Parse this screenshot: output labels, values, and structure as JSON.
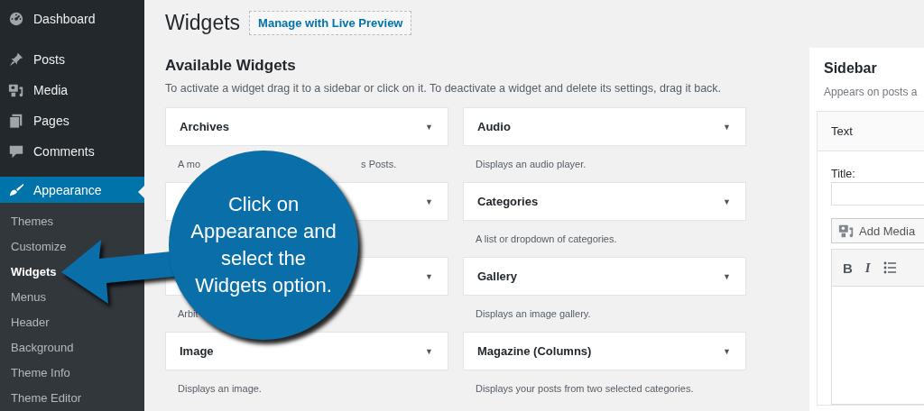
{
  "admin_menu": [
    {
      "label": "Dashboard",
      "selected": false
    },
    {
      "label": "Posts",
      "selected": false
    },
    {
      "label": "Media",
      "selected": false
    },
    {
      "label": "Pages",
      "selected": false
    },
    {
      "label": "Comments",
      "selected": false
    },
    {
      "label": "Appearance",
      "selected": true
    }
  ],
  "submenu": [
    {
      "label": "Themes",
      "selected": false
    },
    {
      "label": "Customize",
      "selected": false
    },
    {
      "label": "Widgets",
      "selected": true
    },
    {
      "label": "Menus",
      "selected": false
    },
    {
      "label": "Header",
      "selected": false
    },
    {
      "label": "Background",
      "selected": false
    },
    {
      "label": "Theme Info",
      "selected": false
    },
    {
      "label": "Theme Editor",
      "selected": false
    }
  ],
  "page": {
    "title": "Widgets",
    "action_button": "Manage with Live Preview"
  },
  "available": {
    "heading": "Available Widgets",
    "description": "To activate a widget drag it to a sidebar or click on it. To deactivate a widget and delete its settings, drag it back.",
    "widgets": [
      {
        "title": "Archives",
        "toggle": "▼",
        "description": [
          "A mo",
          "s Posts."
        ]
      },
      {
        "title": "Audio",
        "toggle": "▼",
        "description": [
          "Displays an audio player."
        ]
      },
      {
        "toggle": "▼"
      },
      {
        "title": "Categories",
        "toggle": "▼",
        "description": [
          "A list or dropdown of categories."
        ]
      },
      {
        "toggle": "▼",
        "description": [
          "Arbit"
        ]
      },
      {
        "title": "Gallery",
        "toggle": "▼",
        "description": [
          "Displays an image gallery."
        ]
      },
      {
        "title": "Image",
        "toggle": "▼",
        "description": [
          "Displays an image."
        ]
      },
      {
        "title": "Magazine (Columns)",
        "toggle": "▼",
        "description": [
          "Displays your posts from two selected categories."
        ]
      }
    ]
  },
  "sidebar_area": {
    "title": "Sidebar",
    "description": "Appears on posts a",
    "widget": {
      "title": "Text",
      "field_label": "Title:",
      "add_media": "Add Media",
      "toolbar": [
        {
          "label": "B",
          "kind": "bold"
        },
        {
          "label": "I",
          "kind": "italic"
        },
        {
          "kind": "list"
        }
      ]
    }
  },
  "callout": {
    "text": "Click on\nAppearance and\nselect the\nWidgets option."
  }
}
